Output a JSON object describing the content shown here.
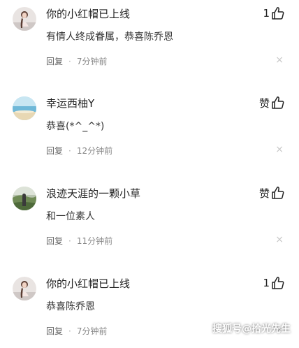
{
  "comments": [
    {
      "username": "你的小红帽已上线",
      "like_label": "1",
      "text": "有情人终成眷属，恭喜陈乔恩",
      "reply_label": "回复",
      "separator": "·",
      "time": "7分钟前",
      "close_glyph": "×",
      "avatar": "girl-photo"
    },
    {
      "username": "幸运西柚Y",
      "like_label": "赞",
      "text": "恭喜(*^_^*)",
      "reply_label": "回复",
      "separator": "·",
      "time": "12分钟前",
      "close_glyph": "×",
      "avatar": "beach-photo"
    },
    {
      "username": "浪迹天涯的一颗小草",
      "like_label": "赞",
      "text": "和一位素人",
      "reply_label": "回复",
      "separator": "·",
      "time": "11分钟前",
      "close_glyph": "×",
      "avatar": "landscape-photo"
    },
    {
      "username": "你的小红帽已上线",
      "like_label": "1",
      "text": "恭喜陈乔恩",
      "reply_label": "回复",
      "separator": "·",
      "time": "7分钟前",
      "close_glyph": "×",
      "avatar": "girl-photo"
    }
  ],
  "watermark": "搜狐号@拾光先生",
  "colors": {
    "username": "#222222",
    "text": "#333333",
    "meta": "#888888",
    "close": "#c8c8c8"
  }
}
